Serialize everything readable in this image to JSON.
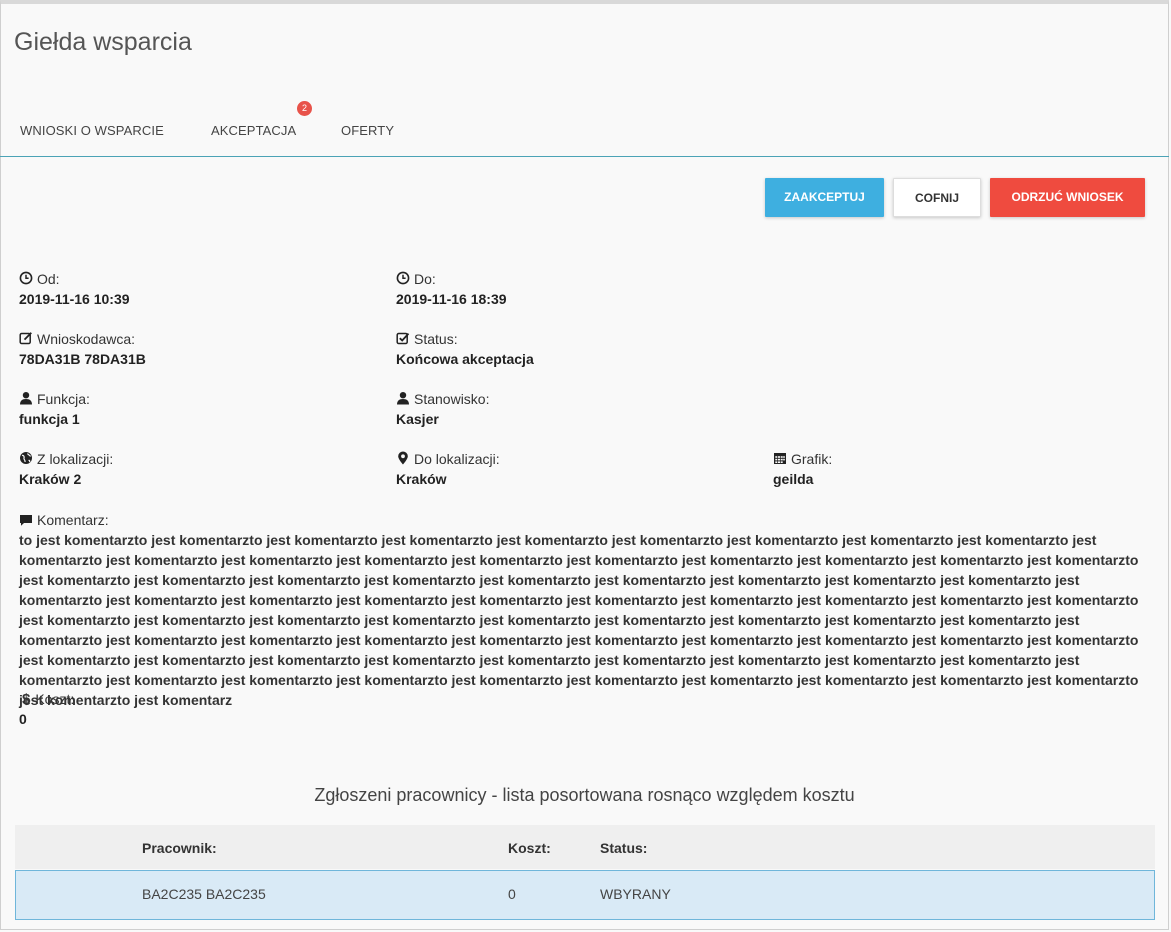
{
  "page": {
    "title": "Giełda wsparcia"
  },
  "tabs": [
    {
      "label": "WNIOSKI O WSPARCIE"
    },
    {
      "label": "AKCEPTACJA",
      "badge": "2"
    },
    {
      "label": "OFERTY"
    }
  ],
  "actions": {
    "accept": "ZAAKCEPTUJ",
    "undo": "COFNIJ",
    "reject": "ODRZUĆ WNIOSEK"
  },
  "details": {
    "from": {
      "label": "Od:",
      "value": "2019-11-16 10:39",
      "icon": "clock-icon"
    },
    "to": {
      "label": "Do:",
      "value": "2019-11-16 18:39",
      "icon": "clock-icon"
    },
    "applicant": {
      "label": "Wnioskodawca:",
      "value": "78DA31B 78DA31B",
      "icon": "edit-icon"
    },
    "status": {
      "label": "Status:",
      "value": "Końcowa akceptacja",
      "icon": "check-square-icon"
    },
    "function": {
      "label": "Funkcja:",
      "value": "funkcja 1",
      "icon": "user-icon"
    },
    "position": {
      "label": "Stanowisko:",
      "value": "Kasjer",
      "icon": "user-icon"
    },
    "from_location": {
      "label": "Z lokalizacji:",
      "value": "Kraków 2",
      "icon": "globe-icon"
    },
    "to_location": {
      "label": "Do lokalizacji:",
      "value": "Kraków",
      "icon": "map-marker-icon"
    },
    "schedule": {
      "label": "Grafik:",
      "value": "geilda",
      "icon": "calendar-icon"
    },
    "comment": {
      "label": "Komentarz:",
      "value": "to jest komentarzto jest komentarzto jest komentarzto jest komentarzto jest komentarzto jest komentarzto jest komentarzto jest komentarzto jest komentarzto jest komentarzto jest komentarzto jest komentarzto jest komentarzto jest komentarzto jest komentarzto jest komentarzto jest komentarzto jest komentarzto jest komentarzto jest komentarzto jest komentarzto jest komentarzto jest komentarzto jest komentarzto jest komentarzto jest komentarzto jest komentarzto jest komentarzto jest komentarzto jest komentarzto jest komentarzto jest komentarzto jest komentarzto jest komentarzto jest komentarzto jest komentarzto jest komentarzto jest komentarzto jest komentarzto jest komentarzto jest komentarzto jest komentarzto jest komentarzto jest komentarzto jest komentarzto jest komentarzto jest komentarzto jest komentarzto jest komentarzto jest komentarzto jest komentarzto jest komentarzto jest komentarzto jest komentarzto jest komentarzto jest komentarzto jest komentarzto jest komentarzto jest komentarzto jest komentarzto jest komentarzto jest komentarzto jest komentarzto jest komentarzto jest komentarzto jest komentarzto jest komentarzto jest komentarzto jest komentarzto jest komentarzto jest komentarzto jest komentarzto jest komentarzto jest komentarzto jest komentarzto jest komentarzto jest komentarzto jest komentarz",
      "icon": "comment-icon"
    },
    "cost": {
      "label": "Koszt:",
      "value": "0",
      "icon": "dollar-icon"
    }
  },
  "workers": {
    "title": "Zgłoszeni pracownicy - lista posortowana rosnąco względem kosztu",
    "headers": {
      "worker": "Pracownik:",
      "cost": "Koszt:",
      "status": "Status:"
    },
    "rows": [
      {
        "worker": "BA2C235 BA2C235",
        "cost": "0",
        "status": "WBYRANY"
      }
    ]
  },
  "colors": {
    "accent": "#3eafe0",
    "danger": "#ef4b3f",
    "badge": "#e8534a",
    "selected_row": "#d9eaf6"
  }
}
